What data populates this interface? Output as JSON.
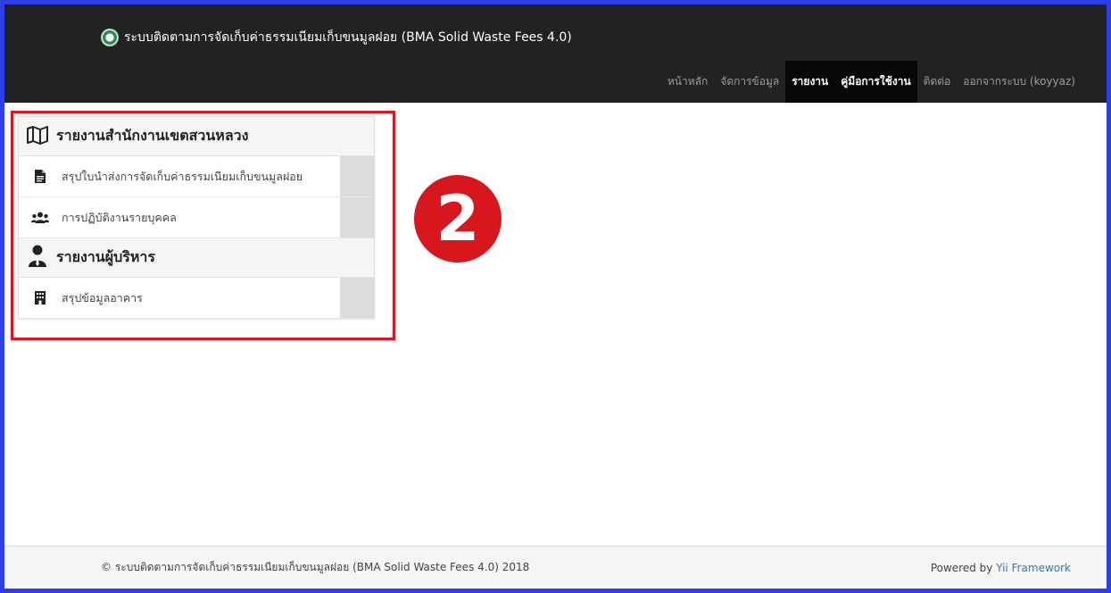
{
  "app": {
    "title": "ระบบติดตามการจัดเก็บค่าธรรมเนียมเก็บขนมูลฝอย (BMA Solid Waste Fees 4.0)"
  },
  "nav": {
    "items": [
      {
        "label": "หน้าหลัก",
        "active": false
      },
      {
        "label": "จัดการข้อมูล",
        "active": false
      },
      {
        "label": "รายงาน",
        "active": true
      },
      {
        "label": "คู่มือการใช้งาน",
        "active": true
      },
      {
        "label": "ติดต่อ",
        "active": false
      },
      {
        "label": "ออกจากระบบ (koyyaz)",
        "active": false
      }
    ]
  },
  "menu": {
    "section1": {
      "heading": "รายงานสำนักงานเขตสวนหลวง",
      "icon": "map-icon",
      "items": [
        {
          "label": "สรุปใบนำส่งการจัดเก็บค่าธรรมเนียมเก็บขนมูลฝอย",
          "icon": "document-icon"
        },
        {
          "label": "การปฏิบัติงานรายบุคคล",
          "icon": "users-icon"
        }
      ]
    },
    "section2": {
      "heading": "รายงานผู้บริหาร",
      "icon": "executive-icon",
      "items": [
        {
          "label": "สรุปข้อมูลอาคาร",
          "icon": "building-icon"
        }
      ]
    }
  },
  "annotation": {
    "number": "2",
    "box_color": "#e4111a",
    "badge_color": "#d7171d"
  },
  "footer": {
    "copyright": "© ระบบติดตามการจัดเก็บค่าธรรมเนียมเก็บขนมูลฝอย (BMA Solid Waste Fees 4.0) 2018",
    "powered_prefix": "Powered by ",
    "powered_link": "Yii Framework"
  },
  "colors": {
    "frame_border": "#2f3ee8",
    "navbar_bg": "#222222",
    "link": "#337ab7"
  }
}
